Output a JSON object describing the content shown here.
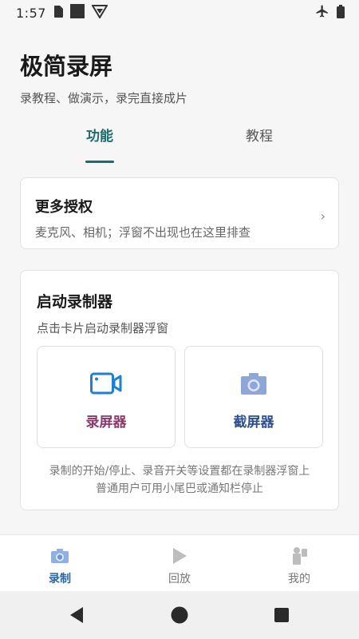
{
  "status_bar": {
    "time": "1:57"
  },
  "header": {
    "title": "极简录屏",
    "subtitle": "录教程、做演示，录完直接成片"
  },
  "tabs": [
    {
      "label": "功能",
      "active": true
    },
    {
      "label": "教程",
      "active": false
    }
  ],
  "permissions_card": {
    "title": "更多授权",
    "description": "麦克风、相机；浮窗不出现也在这里排查",
    "chevron": "›"
  },
  "recorder_card": {
    "title": "启动录制器",
    "description": "点击卡片启动录制器浮窗",
    "tiles": [
      {
        "label": "录屏器",
        "icon": "video-camera-icon",
        "color": "#8a3a6a"
      },
      {
        "label": "截屏器",
        "icon": "camera-icon",
        "color": "#2e4f8e"
      }
    ],
    "note_line1": "录制的开始/停止、录音开关等设置都在录制器浮窗上",
    "note_line2": "普通用户可用小尾巴或通知栏停止"
  },
  "bottom_nav": [
    {
      "label": "录制",
      "icon": "camera-icon",
      "active": true
    },
    {
      "label": "回放",
      "icon": "play-icon",
      "active": false
    },
    {
      "label": "我的",
      "icon": "person-icon",
      "active": false
    }
  ],
  "colors": {
    "accent_teal": "#1e6b6b",
    "accent_blue": "#2966a8",
    "background": "#f6f6f6"
  }
}
